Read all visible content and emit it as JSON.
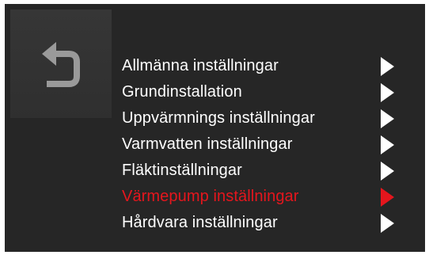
{
  "back": {
    "icon": "undo-arrow-icon"
  },
  "menu": {
    "items": [
      {
        "label": "Allmänna inställningar",
        "active": false
      },
      {
        "label": "Grundinstallation",
        "active": false
      },
      {
        "label": "Uppvärmnings inställningar",
        "active": false
      },
      {
        "label": "Varmvatten inställningar",
        "active": false
      },
      {
        "label": "Fläktinställningar",
        "active": false
      },
      {
        "label": "Värmepump inställningar",
        "active": true
      },
      {
        "label": "Hårdvara inställningar",
        "active": false
      }
    ],
    "arrow_icon": "chevron-right-triangle-icon"
  },
  "colors": {
    "background": "#262626",
    "text": "#ffffff",
    "active": "#e5161d",
    "back_icon": "#9a9a9a"
  }
}
